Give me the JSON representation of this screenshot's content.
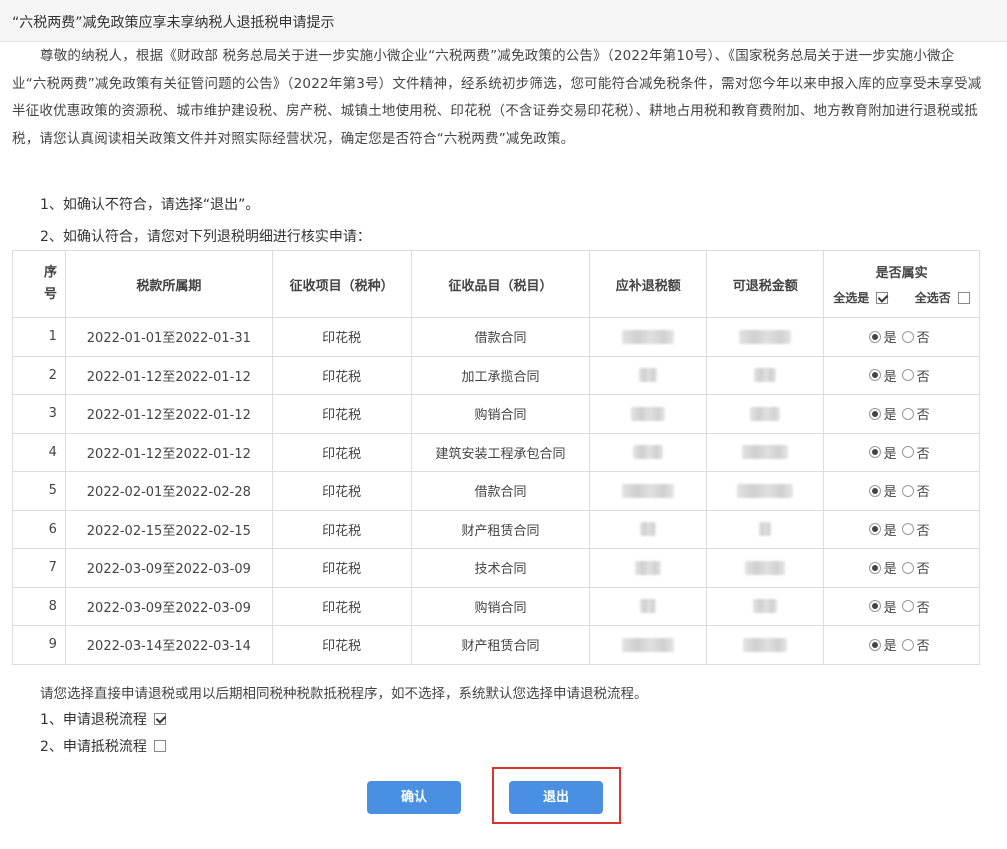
{
  "dialog": {
    "title": "“六税两费”减免政策应享未享纳税人退抵税申请提示",
    "intro": "尊敬的纳税人，根据《财政部 税务总局关于进一步实施小微企业“六税两费”减免政策的公告》（2022年第10号）、《国家税务总局关于进一步实施小微企业“六税两费”减免政策有关征管问题的公告》（2022年第3号）文件精神，经系统初步筛选，您可能符合减免税条件，需对您今年以来申报入库的应享受未享受减半征收优惠政策的资源税、城市维护建设税、房产税、城镇土地使用税、印花税（不含证券交易印花税）、耕地占用税和教育费附加、地方教育附加进行退税或抵税，请您认真阅读相关政策文件并对照实际经营状况，确定您是否符合“六税两费”减免政策。",
    "step1": "1、如确认不符合，请选择“退出”。",
    "step2": "2、如确认符合，请您对下列退税明细进行核实申请："
  },
  "table": {
    "headers": {
      "seq": "序号",
      "period": "税款所属期",
      "item": "征收项目（税种）",
      "subitem": "征收品目（税目）",
      "refund_due": "应补退税额",
      "refundable": "可退税金额",
      "confirm": "是否属实",
      "select_all_yes": "全选是",
      "select_all_no": "全选否"
    },
    "yes_label": "是",
    "no_label": "否",
    "rows": [
      {
        "seq": "1",
        "period": "2022-01-01至2022-01-31",
        "item": "印花税",
        "subitem": "借款合同",
        "answer": "是"
      },
      {
        "seq": "2",
        "period": "2022-01-12至2022-01-12",
        "item": "印花税",
        "subitem": "加工承揽合同",
        "answer": "是"
      },
      {
        "seq": "3",
        "period": "2022-01-12至2022-01-12",
        "item": "印花税",
        "subitem": "购销合同",
        "answer": "是"
      },
      {
        "seq": "4",
        "period": "2022-01-12至2022-01-12",
        "item": "印花税",
        "subitem": "建筑安装工程承包合同",
        "answer": "是"
      },
      {
        "seq": "5",
        "period": "2022-02-01至2022-02-28",
        "item": "印花税",
        "subitem": "借款合同",
        "answer": "是"
      },
      {
        "seq": "6",
        "period": "2022-02-15至2022-02-15",
        "item": "印花税",
        "subitem": "财产租赁合同",
        "answer": "是"
      },
      {
        "seq": "7",
        "period": "2022-03-09至2022-03-09",
        "item": "印花税",
        "subitem": "技术合同",
        "answer": "是"
      },
      {
        "seq": "8",
        "period": "2022-03-09至2022-03-09",
        "item": "印花税",
        "subitem": "购销合同",
        "answer": "是"
      },
      {
        "seq": "9",
        "period": "2022-03-14至2022-03-14",
        "item": "印花税",
        "subitem": "财产租赁合同",
        "answer": "是"
      }
    ]
  },
  "process": {
    "note": "请您选择直接申请退税或用以后期相同税种税款抵税程序，如不选择，系统默认您选择申请退税流程。",
    "option1": "1、申请退税流程",
    "option1_checked": true,
    "option2": "2、申请抵税流程",
    "option2_checked": false
  },
  "buttons": {
    "confirm": "确认",
    "exit": "退出"
  },
  "colors": {
    "button_bg": "#4a90e2",
    "highlight_border": "#d9352f"
  }
}
